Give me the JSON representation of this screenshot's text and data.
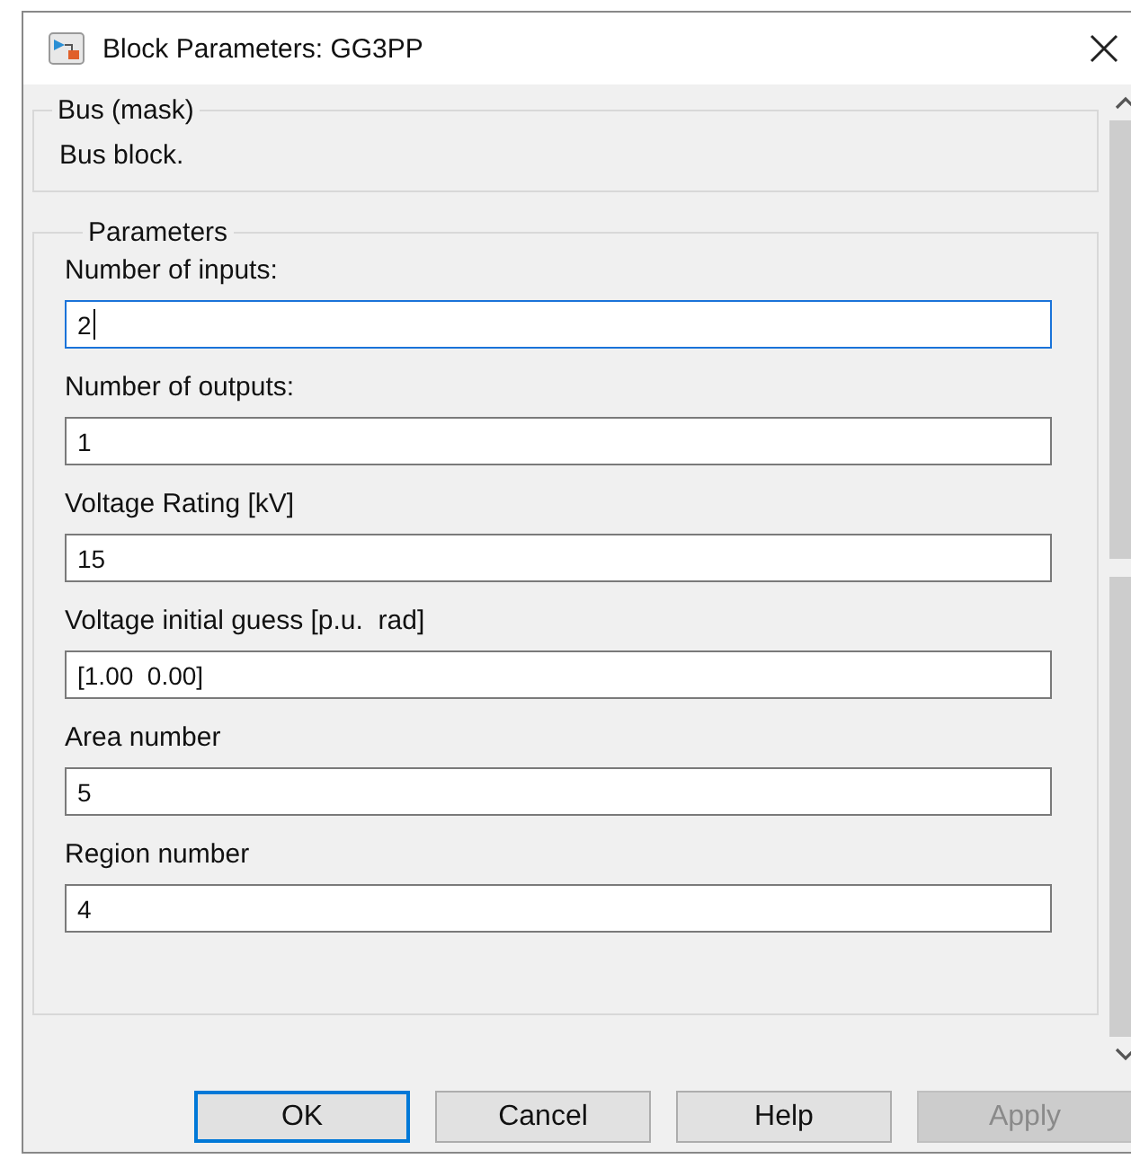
{
  "window": {
    "title": "Block Parameters: GG3PP"
  },
  "description_group": {
    "title": "Bus (mask)",
    "text": "Bus block."
  },
  "parameters_group": {
    "title": "Parameters",
    "fields": [
      {
        "label": "Number of inputs:",
        "value": "2",
        "focused": true
      },
      {
        "label": "Number of outputs:",
        "value": "1",
        "focused": false
      },
      {
        "label": "Voltage Rating [kV]",
        "value": "15",
        "focused": false
      },
      {
        "label": "Voltage initial guess [p.u.  rad]",
        "value": "[1.00  0.00]",
        "focused": false
      },
      {
        "label": "Area number",
        "value": "5",
        "focused": false
      },
      {
        "label": "Region number",
        "value": "4",
        "focused": false
      }
    ]
  },
  "buttons": [
    {
      "label": "OK",
      "default": true,
      "disabled": false
    },
    {
      "label": "Cancel",
      "default": false,
      "disabled": false
    },
    {
      "label": "Help",
      "default": false,
      "disabled": false
    },
    {
      "label": "Apply",
      "default": false,
      "disabled": true
    }
  ]
}
